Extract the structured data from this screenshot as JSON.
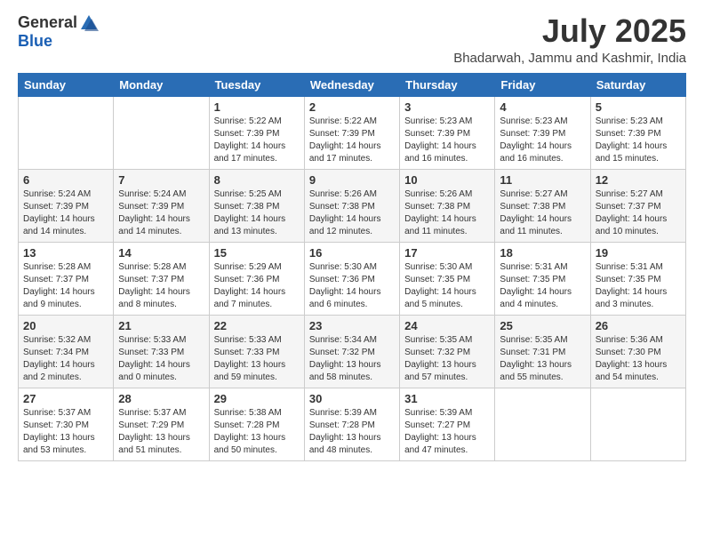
{
  "logo": {
    "general": "General",
    "blue": "Blue"
  },
  "title": {
    "month_year": "July 2025",
    "location": "Bhadarwah, Jammu and Kashmir, India"
  },
  "header_days": [
    "Sunday",
    "Monday",
    "Tuesday",
    "Wednesday",
    "Thursday",
    "Friday",
    "Saturday"
  ],
  "weeks": [
    {
      "row_class": "",
      "days": [
        {
          "num": "",
          "detail": ""
        },
        {
          "num": "",
          "detail": ""
        },
        {
          "num": "1",
          "detail": "Sunrise: 5:22 AM\nSunset: 7:39 PM\nDaylight: 14 hours\nand 17 minutes."
        },
        {
          "num": "2",
          "detail": "Sunrise: 5:22 AM\nSunset: 7:39 PM\nDaylight: 14 hours\nand 17 minutes."
        },
        {
          "num": "3",
          "detail": "Sunrise: 5:23 AM\nSunset: 7:39 PM\nDaylight: 14 hours\nand 16 minutes."
        },
        {
          "num": "4",
          "detail": "Sunrise: 5:23 AM\nSunset: 7:39 PM\nDaylight: 14 hours\nand 16 minutes."
        },
        {
          "num": "5",
          "detail": "Sunrise: 5:23 AM\nSunset: 7:39 PM\nDaylight: 14 hours\nand 15 minutes."
        }
      ]
    },
    {
      "row_class": "alt-row",
      "days": [
        {
          "num": "6",
          "detail": "Sunrise: 5:24 AM\nSunset: 7:39 PM\nDaylight: 14 hours\nand 14 minutes."
        },
        {
          "num": "7",
          "detail": "Sunrise: 5:24 AM\nSunset: 7:39 PM\nDaylight: 14 hours\nand 14 minutes."
        },
        {
          "num": "8",
          "detail": "Sunrise: 5:25 AM\nSunset: 7:38 PM\nDaylight: 14 hours\nand 13 minutes."
        },
        {
          "num": "9",
          "detail": "Sunrise: 5:26 AM\nSunset: 7:38 PM\nDaylight: 14 hours\nand 12 minutes."
        },
        {
          "num": "10",
          "detail": "Sunrise: 5:26 AM\nSunset: 7:38 PM\nDaylight: 14 hours\nand 11 minutes."
        },
        {
          "num": "11",
          "detail": "Sunrise: 5:27 AM\nSunset: 7:38 PM\nDaylight: 14 hours\nand 11 minutes."
        },
        {
          "num": "12",
          "detail": "Sunrise: 5:27 AM\nSunset: 7:37 PM\nDaylight: 14 hours\nand 10 minutes."
        }
      ]
    },
    {
      "row_class": "",
      "days": [
        {
          "num": "13",
          "detail": "Sunrise: 5:28 AM\nSunset: 7:37 PM\nDaylight: 14 hours\nand 9 minutes."
        },
        {
          "num": "14",
          "detail": "Sunrise: 5:28 AM\nSunset: 7:37 PM\nDaylight: 14 hours\nand 8 minutes."
        },
        {
          "num": "15",
          "detail": "Sunrise: 5:29 AM\nSunset: 7:36 PM\nDaylight: 14 hours\nand 7 minutes."
        },
        {
          "num": "16",
          "detail": "Sunrise: 5:30 AM\nSunset: 7:36 PM\nDaylight: 14 hours\nand 6 minutes."
        },
        {
          "num": "17",
          "detail": "Sunrise: 5:30 AM\nSunset: 7:35 PM\nDaylight: 14 hours\nand 5 minutes."
        },
        {
          "num": "18",
          "detail": "Sunrise: 5:31 AM\nSunset: 7:35 PM\nDaylight: 14 hours\nand 4 minutes."
        },
        {
          "num": "19",
          "detail": "Sunrise: 5:31 AM\nSunset: 7:35 PM\nDaylight: 14 hours\nand 3 minutes."
        }
      ]
    },
    {
      "row_class": "alt-row",
      "days": [
        {
          "num": "20",
          "detail": "Sunrise: 5:32 AM\nSunset: 7:34 PM\nDaylight: 14 hours\nand 2 minutes."
        },
        {
          "num": "21",
          "detail": "Sunrise: 5:33 AM\nSunset: 7:33 PM\nDaylight: 14 hours\nand 0 minutes."
        },
        {
          "num": "22",
          "detail": "Sunrise: 5:33 AM\nSunset: 7:33 PM\nDaylight: 13 hours\nand 59 minutes."
        },
        {
          "num": "23",
          "detail": "Sunrise: 5:34 AM\nSunset: 7:32 PM\nDaylight: 13 hours\nand 58 minutes."
        },
        {
          "num": "24",
          "detail": "Sunrise: 5:35 AM\nSunset: 7:32 PM\nDaylight: 13 hours\nand 57 minutes."
        },
        {
          "num": "25",
          "detail": "Sunrise: 5:35 AM\nSunset: 7:31 PM\nDaylight: 13 hours\nand 55 minutes."
        },
        {
          "num": "26",
          "detail": "Sunrise: 5:36 AM\nSunset: 7:30 PM\nDaylight: 13 hours\nand 54 minutes."
        }
      ]
    },
    {
      "row_class": "",
      "days": [
        {
          "num": "27",
          "detail": "Sunrise: 5:37 AM\nSunset: 7:30 PM\nDaylight: 13 hours\nand 53 minutes."
        },
        {
          "num": "28",
          "detail": "Sunrise: 5:37 AM\nSunset: 7:29 PM\nDaylight: 13 hours\nand 51 minutes."
        },
        {
          "num": "29",
          "detail": "Sunrise: 5:38 AM\nSunset: 7:28 PM\nDaylight: 13 hours\nand 50 minutes."
        },
        {
          "num": "30",
          "detail": "Sunrise: 5:39 AM\nSunset: 7:28 PM\nDaylight: 13 hours\nand 48 minutes."
        },
        {
          "num": "31",
          "detail": "Sunrise: 5:39 AM\nSunset: 7:27 PM\nDaylight: 13 hours\nand 47 minutes."
        },
        {
          "num": "",
          "detail": ""
        },
        {
          "num": "",
          "detail": ""
        }
      ]
    }
  ]
}
